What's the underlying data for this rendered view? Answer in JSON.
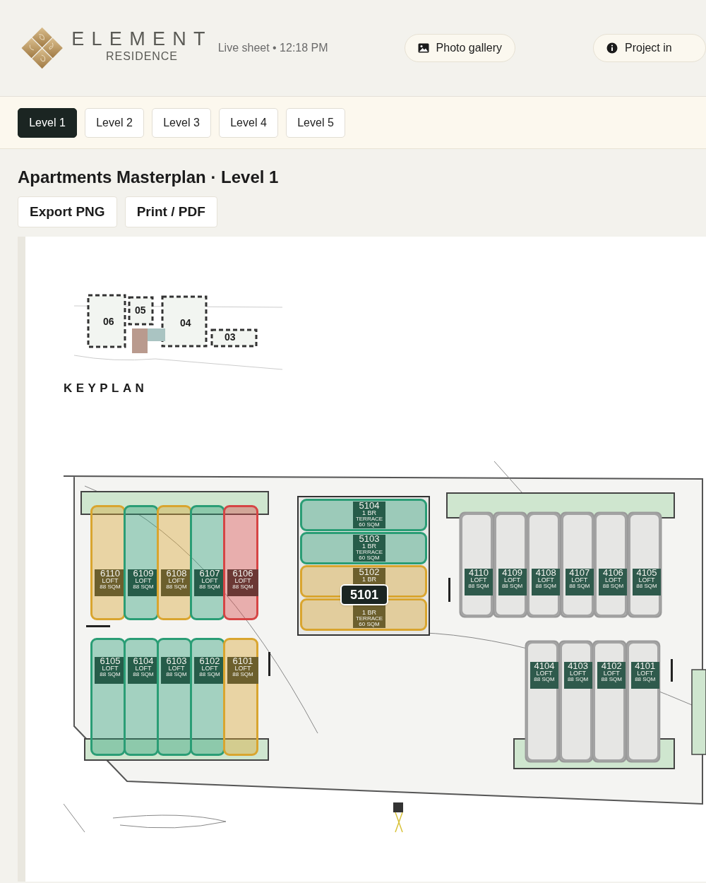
{
  "header": {
    "brand": "ELEMENT",
    "brand_subtitle": "RESIDENCE",
    "status": "Live sheet • 12:18 PM",
    "buttons": [
      {
        "kind": "gallery",
        "label": "Photo gallery"
      },
      {
        "kind": "info",
        "label": "Project in"
      }
    ]
  },
  "level_tabs": [
    {
      "label": "Level 1",
      "selected": true
    },
    {
      "label": "Level 2",
      "selected": false
    },
    {
      "label": "Level 3",
      "selected": false
    },
    {
      "label": "Level 4",
      "selected": false
    },
    {
      "label": "Level 5",
      "selected": false
    }
  ],
  "title": "Apartments Masterplan · Level 1",
  "actions": [
    "Export PNG",
    "Print / PDF"
  ],
  "keyplan": {
    "label": "KEYPLAN",
    "blocks": [
      "06",
      "05",
      "04",
      "03"
    ]
  },
  "plan": {
    "buildings": [
      {
        "units": [
          {
            "number": "6110",
            "type": "LOFT",
            "area": "88 SQM",
            "color": "#d9a52f"
          },
          {
            "number": "6109",
            "type": "LOFT",
            "area": "88 SQM",
            "color": "#2a9d75"
          },
          {
            "number": "6108",
            "type": "LOFT",
            "area": "88 SQM",
            "color": "#d9a52f"
          },
          {
            "number": "6107",
            "type": "LOFT",
            "area": "88 SQM",
            "color": "#2a9d75"
          },
          {
            "number": "6106",
            "type": "LOFT",
            "area": "88 SQM",
            "color": "#d64545"
          }
        ]
      },
      {
        "units": [
          {
            "number": "6105",
            "type": "LOFT",
            "area": "88 SQM",
            "color": "#2a9d75"
          },
          {
            "number": "6104",
            "type": "LOFT",
            "area": "88 SQM",
            "color": "#2a9d75"
          },
          {
            "number": "6103",
            "type": "LOFT",
            "area": "88 SQM",
            "color": "#2a9d75"
          },
          {
            "number": "6102",
            "type": "LOFT",
            "area": "88 SQM",
            "color": "#2a9d75"
          },
          {
            "number": "6101",
            "type": "LOFT",
            "area": "88 SQM",
            "color": "#d9a52f"
          }
        ]
      },
      {
        "units": [
          {
            "number": "5104",
            "type": "1 BR",
            "note": "TERRACE",
            "area": "60 SQM",
            "color": "#2a9d75"
          },
          {
            "number": "5103",
            "type": "1 BR",
            "note": "TERRACE",
            "area": "60 SQM",
            "color": "#2a9d75"
          },
          {
            "number": "5102",
            "type": "1 BR",
            "color": "#d9a52f"
          },
          {
            "type": "1 BR",
            "note": "TERRACE",
            "area": "60 SQM",
            "color": "#d9a52f"
          }
        ]
      },
      {
        "units": [
          {
            "number": "4110",
            "type": "LOFT",
            "area": "88 SQM"
          },
          {
            "number": "4109",
            "type": "LOFT",
            "area": "88 SQM"
          },
          {
            "number": "4108",
            "type": "LOFT",
            "area": "88 SQM"
          },
          {
            "number": "4107",
            "type": "LOFT",
            "area": "88 SQM"
          },
          {
            "number": "4106",
            "type": "LOFT",
            "area": "88 SQM"
          },
          {
            "number": "4105",
            "type": "LOFT",
            "area": "88 SQM"
          }
        ]
      },
      {
        "units": [
          {
            "number": "4104",
            "type": "LOFT",
            "area": "88 SQM"
          },
          {
            "number": "4103",
            "type": "LOFT",
            "area": "88 SQM"
          },
          {
            "number": "4102",
            "type": "LOFT",
            "area": "88 SQM"
          },
          {
            "number": "4101",
            "type": "LOFT",
            "area": "88 SQM"
          }
        ]
      }
    ],
    "tooltip": "5101"
  }
}
